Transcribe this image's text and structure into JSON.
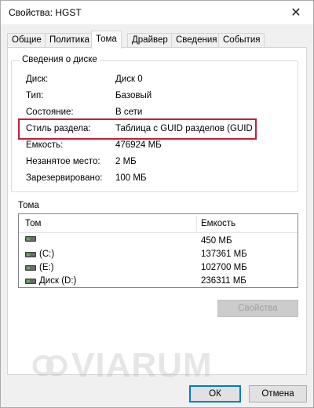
{
  "window": {
    "title": "Свойства: HGST"
  },
  "tabs": [
    {
      "label": "Общие"
    },
    {
      "label": "Политика"
    },
    {
      "label": "Тома"
    },
    {
      "label": "Драйвер"
    },
    {
      "label": "Сведения"
    },
    {
      "label": "События"
    }
  ],
  "active_tab": "Тома",
  "disk_info": {
    "group_title": "Сведения о диске",
    "rows": [
      {
        "label": "Диск:",
        "value": "Диск 0"
      },
      {
        "label": "Тип:",
        "value": "Базовый"
      },
      {
        "label": "Состояние:",
        "value": "В сети"
      },
      {
        "label": "Стиль раздела:",
        "value": "Таблица с GUID разделов (GUID"
      },
      {
        "label": "Емкость:",
        "value": "476924 МБ"
      },
      {
        "label": "Незанятое место:",
        "value": "2 МБ"
      },
      {
        "label": "Зарезервировано:",
        "value": "100 МБ"
      }
    ]
  },
  "volumes": {
    "section_label": "Тома",
    "columns": {
      "volume": "Том",
      "capacity": "Емкость"
    },
    "rows": [
      {
        "name": "",
        "capacity": "450 МБ"
      },
      {
        "name": "(C:)",
        "capacity": "137361 МБ"
      },
      {
        "name": "(E:)",
        "capacity": "102700 МБ"
      },
      {
        "name": "Диск (D:)",
        "capacity": "236311 МБ"
      }
    ]
  },
  "buttons": {
    "properties": "Свойства",
    "ok": "ОК",
    "cancel": "Отмена"
  },
  "watermark": {
    "text": "VIARUM"
  },
  "colors": {
    "highlight_border": "#c0203c",
    "default_button_border": "#0078d7"
  },
  "icons": {
    "close": "close-icon",
    "volume": "disk-volume-icon"
  }
}
